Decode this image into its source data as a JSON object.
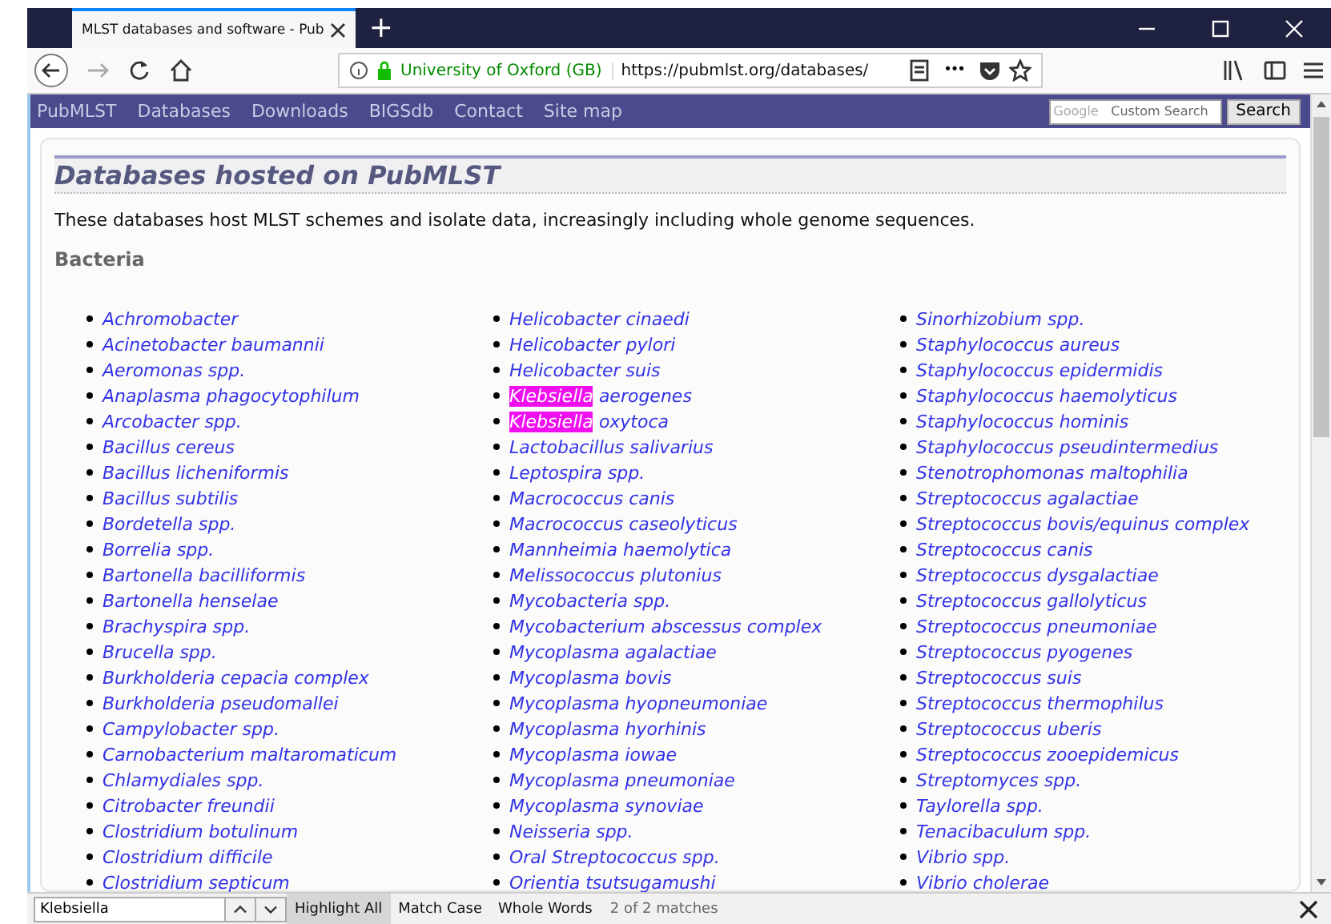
{
  "window": {
    "tab_title": "MLST databases and software - Pub",
    "new_tab": "+"
  },
  "toolbar": {
    "site_identity": "University of Oxford (GB)",
    "url": "https://pubmlst.org/databases/",
    "more": "•••"
  },
  "site_nav": {
    "items": [
      "PubMLST",
      "Databases",
      "Downloads",
      "BIGSdb",
      "Contact",
      "Site map"
    ],
    "search_placeholder": "Custom Search",
    "search_brand": "Google",
    "search_button": "Search"
  },
  "page": {
    "heading": "Databases hosted on PubMLST",
    "intro": "These databases host MLST schemes and isolate data, increasingly including whole genome sequences.",
    "section": "Bacteria",
    "columns": [
      [
        {
          "text": "Achromobacter"
        },
        {
          "text": "Acinetobacter baumannii"
        },
        {
          "text": "Aeromonas spp."
        },
        {
          "text": "Anaplasma phagocytophilum"
        },
        {
          "text": "Arcobacter spp."
        },
        {
          "text": "Bacillus cereus"
        },
        {
          "text": "Bacillus licheniformis"
        },
        {
          "text": "Bacillus subtilis"
        },
        {
          "text": "Bordetella spp."
        },
        {
          "text": "Borrelia spp."
        },
        {
          "text": "Bartonella bacilliformis"
        },
        {
          "text": "Bartonella henselae"
        },
        {
          "text": "Brachyspira spp."
        },
        {
          "text": "Brucella spp."
        },
        {
          "text": "Burkholderia cepacia complex"
        },
        {
          "text": "Burkholderia pseudomallei"
        },
        {
          "text": "Campylobacter spp."
        },
        {
          "text": "Carnobacterium maltaromaticum"
        },
        {
          "text": "Chlamydiales spp."
        },
        {
          "text": "Citrobacter freundii"
        },
        {
          "text": "Clostridium botulinum"
        },
        {
          "text": "Clostridium difficile"
        },
        {
          "text": "Clostridium septicum"
        }
      ],
      [
        {
          "text": "Helicobacter cinaedi"
        },
        {
          "text": "Helicobacter pylori"
        },
        {
          "text": "Helicobacter suis"
        },
        {
          "highlighted_part": "Klebsiella",
          "text": "aerogenes"
        },
        {
          "highlighted_part": "Klebsiella",
          "text": "oxytoca"
        },
        {
          "text": "Lactobacillus salivarius"
        },
        {
          "text": "Leptospira spp."
        },
        {
          "text": "Macrococcus canis"
        },
        {
          "text": "Macrococcus caseolyticus"
        },
        {
          "text": "Mannheimia haemolytica"
        },
        {
          "text": "Melissococcus plutonius"
        },
        {
          "text": "Mycobacteria spp."
        },
        {
          "text": "Mycobacterium abscessus complex"
        },
        {
          "text": "Mycoplasma agalactiae"
        },
        {
          "text": "Mycoplasma bovis"
        },
        {
          "text": "Mycoplasma hyopneumoniae"
        },
        {
          "text": "Mycoplasma hyorhinis"
        },
        {
          "text": "Mycoplasma iowae"
        },
        {
          "text": "Mycoplasma pneumoniae"
        },
        {
          "text": "Mycoplasma synoviae"
        },
        {
          "text": "Neisseria spp."
        },
        {
          "text": "Oral Streptococcus spp."
        },
        {
          "text": "Orientia tsutsugamushi"
        }
      ],
      [
        {
          "text": "Sinorhizobium spp."
        },
        {
          "text": "Staphylococcus aureus"
        },
        {
          "text": "Staphylococcus epidermidis"
        },
        {
          "text": "Staphylococcus haemolyticus"
        },
        {
          "text": "Staphylococcus hominis"
        },
        {
          "text": "Staphylococcus pseudintermedius"
        },
        {
          "text": "Stenotrophomonas maltophilia"
        },
        {
          "text": "Streptococcus agalactiae"
        },
        {
          "text": "Streptococcus bovis/equinus complex"
        },
        {
          "text": "Streptococcus canis"
        },
        {
          "text": "Streptococcus dysgalactiae"
        },
        {
          "text": "Streptococcus gallolyticus"
        },
        {
          "text": "Streptococcus pneumoniae"
        },
        {
          "text": "Streptococcus pyogenes"
        },
        {
          "text": "Streptococcus suis"
        },
        {
          "text": "Streptococcus thermophilus"
        },
        {
          "text": "Streptococcus uberis"
        },
        {
          "text": "Streptococcus zooepidemicus"
        },
        {
          "text": "Streptomyces spp."
        },
        {
          "text": "Taylorella spp."
        },
        {
          "text": "Tenacibaculum spp."
        },
        {
          "text": "Vibrio spp."
        },
        {
          "text": "Vibrio cholerae"
        }
      ]
    ]
  },
  "find_bar": {
    "value": "Klebsiella",
    "options": [
      {
        "label": "Highlight All",
        "selected": true
      },
      {
        "label": "Match Case",
        "selected": false
      },
      {
        "label": "Whole Words",
        "selected": false
      }
    ],
    "status": "2 of 2 matches"
  }
}
